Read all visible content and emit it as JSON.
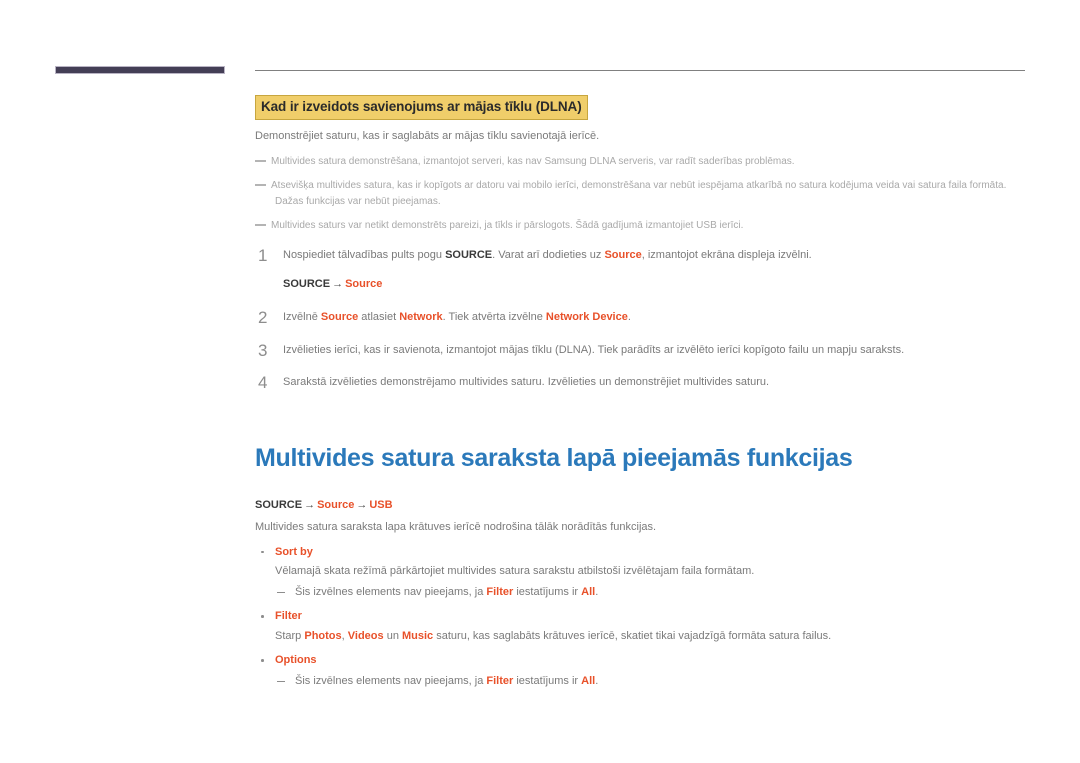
{
  "page": {
    "header": {
      "tab_name": "chapter-tab-marker",
      "rule_name": "header-rule"
    }
  },
  "section_dlna": {
    "heading": "Kad ir izveidots savienojums ar mājas tīklu (DLNA)",
    "intro": "Demonstrējiet saturu, kas ir saglabāts ar mājas tīklu savienotajā ierīcē.",
    "notes": [
      {
        "text": "Multivides satura demonstrēšana, izmantojot serveri, kas nav Samsung DLNA serveris, var radīt saderības problēmas.",
        "continuation": ""
      },
      {
        "text": "Atsevišķa multivides satura, kas ir kopīgots ar datoru vai mobilo ierīci, demonstrēšana var nebūt iespējama atkarībā no satura kodējuma veida vai satura faila formāta.",
        "continuation": "Dažas funkcijas var nebūt pieejamas."
      },
      {
        "text": "Multivides saturs var netikt demonstrēts pareizi, ja tīkls ir pārslogots. Šādā gadījumā izmantojiet USB ierīci.",
        "continuation": ""
      }
    ],
    "steps": [
      {
        "number": "1",
        "parts": [
          {
            "t": "Nospiediet tālvadības pults pogu ",
            "s": "plain"
          },
          {
            "t": "SOURCE",
            "s": "bold"
          },
          {
            "t": ". Varat arī dodieties uz ",
            "s": "plain"
          },
          {
            "t": "Source",
            "s": "orange"
          },
          {
            "t": ", izmantojot ekrāna displeja izvēlni.",
            "s": "plain"
          }
        ],
        "path": [
          {
            "t": "SOURCE",
            "s": "bold"
          },
          {
            "t": "→",
            "s": "arrow"
          },
          {
            "t": "Source",
            "s": "orange"
          }
        ]
      },
      {
        "number": "2",
        "parts": [
          {
            "t": "Izvēlnē ",
            "s": "plain"
          },
          {
            "t": "Source",
            "s": "orange"
          },
          {
            "t": " atlasiet ",
            "s": "plain"
          },
          {
            "t": "Network",
            "s": "orange"
          },
          {
            "t": ". Tiek atvērta izvēlne ",
            "s": "plain"
          },
          {
            "t": "Network Device",
            "s": "orange"
          },
          {
            "t": ".",
            "s": "plain"
          }
        ],
        "path": []
      },
      {
        "number": "3",
        "parts": [
          {
            "t": "Izvēlieties ierīci, kas ir savienota, izmantojot mājas tīklu (DLNA). Tiek parādīts ar izvēlēto ierīci kopīgoto failu un mapju saraksts.",
            "s": "plain"
          }
        ],
        "path": []
      },
      {
        "number": "4",
        "parts": [
          {
            "t": "Sarakstā izvēlieties demonstrējamo multivides saturu. Izvēlieties un demonstrējiet multivides saturu.",
            "s": "plain"
          }
        ],
        "path": []
      }
    ]
  },
  "section_functions": {
    "title": "Multivides satura saraksta lapā pieejamās funkcijas",
    "breadcrumb": [
      {
        "t": "SOURCE",
        "s": "bold"
      },
      {
        "t": "→",
        "s": "arrow"
      },
      {
        "t": "Source",
        "s": "orange"
      },
      {
        "t": "→",
        "s": "arrow"
      },
      {
        "t": "USB",
        "s": "orange"
      }
    ],
    "intro": "Multivides satura saraksta lapa krātuves ierīcē nodrošina tālāk norādītās funkcijas.",
    "bullets": [
      {
        "label": "Sort by",
        "body": "Vēlamajā skata režīmā pārkārtojiet multivides satura sarakstu atbilstoši izvēlētajam faila formātam.",
        "subnotes": [
          [
            {
              "t": "Šis izvēlnes elements nav pieejams, ja ",
              "s": "plain"
            },
            {
              "t": "Filter",
              "s": "orange"
            },
            {
              "t": " iestatījums ir ",
              "s": "plain"
            },
            {
              "t": "All",
              "s": "orange"
            },
            {
              "t": ".",
              "s": "plain"
            }
          ]
        ]
      },
      {
        "label": "Filter",
        "body_parts": [
          {
            "t": "Starp ",
            "s": "plain"
          },
          {
            "t": "Photos",
            "s": "orange"
          },
          {
            "t": ", ",
            "s": "plain"
          },
          {
            "t": "Videos",
            "s": "orange"
          },
          {
            "t": " un ",
            "s": "plain"
          },
          {
            "t": "Music",
            "s": "orange"
          },
          {
            "t": " saturu, kas saglabāts krātuves ierīcē, skatiet tikai vajadzīgā formāta satura failus.",
            "s": "plain"
          }
        ],
        "subnotes": []
      },
      {
        "label": "Options",
        "body": "",
        "subnotes": [
          [
            {
              "t": "Šis izvēlnes elements nav pieejams, ja ",
              "s": "plain"
            },
            {
              "t": "Filter",
              "s": "orange"
            },
            {
              "t": " iestatījums ir ",
              "s": "plain"
            },
            {
              "t": "All",
              "s": "orange"
            },
            {
              "t": ".",
              "s": "plain"
            }
          ]
        ]
      }
    ]
  },
  "colors": {
    "highlight_bg": "#f0ce6a",
    "highlight_border": "#c7a63f",
    "chapter_blue": "#2b79ba",
    "accent_orange": "#e8512a",
    "body_gray": "#7a7a7a",
    "note_gray": "#a9a9a9",
    "tab_dark": "#443f56",
    "rule_gray": "#808080"
  }
}
